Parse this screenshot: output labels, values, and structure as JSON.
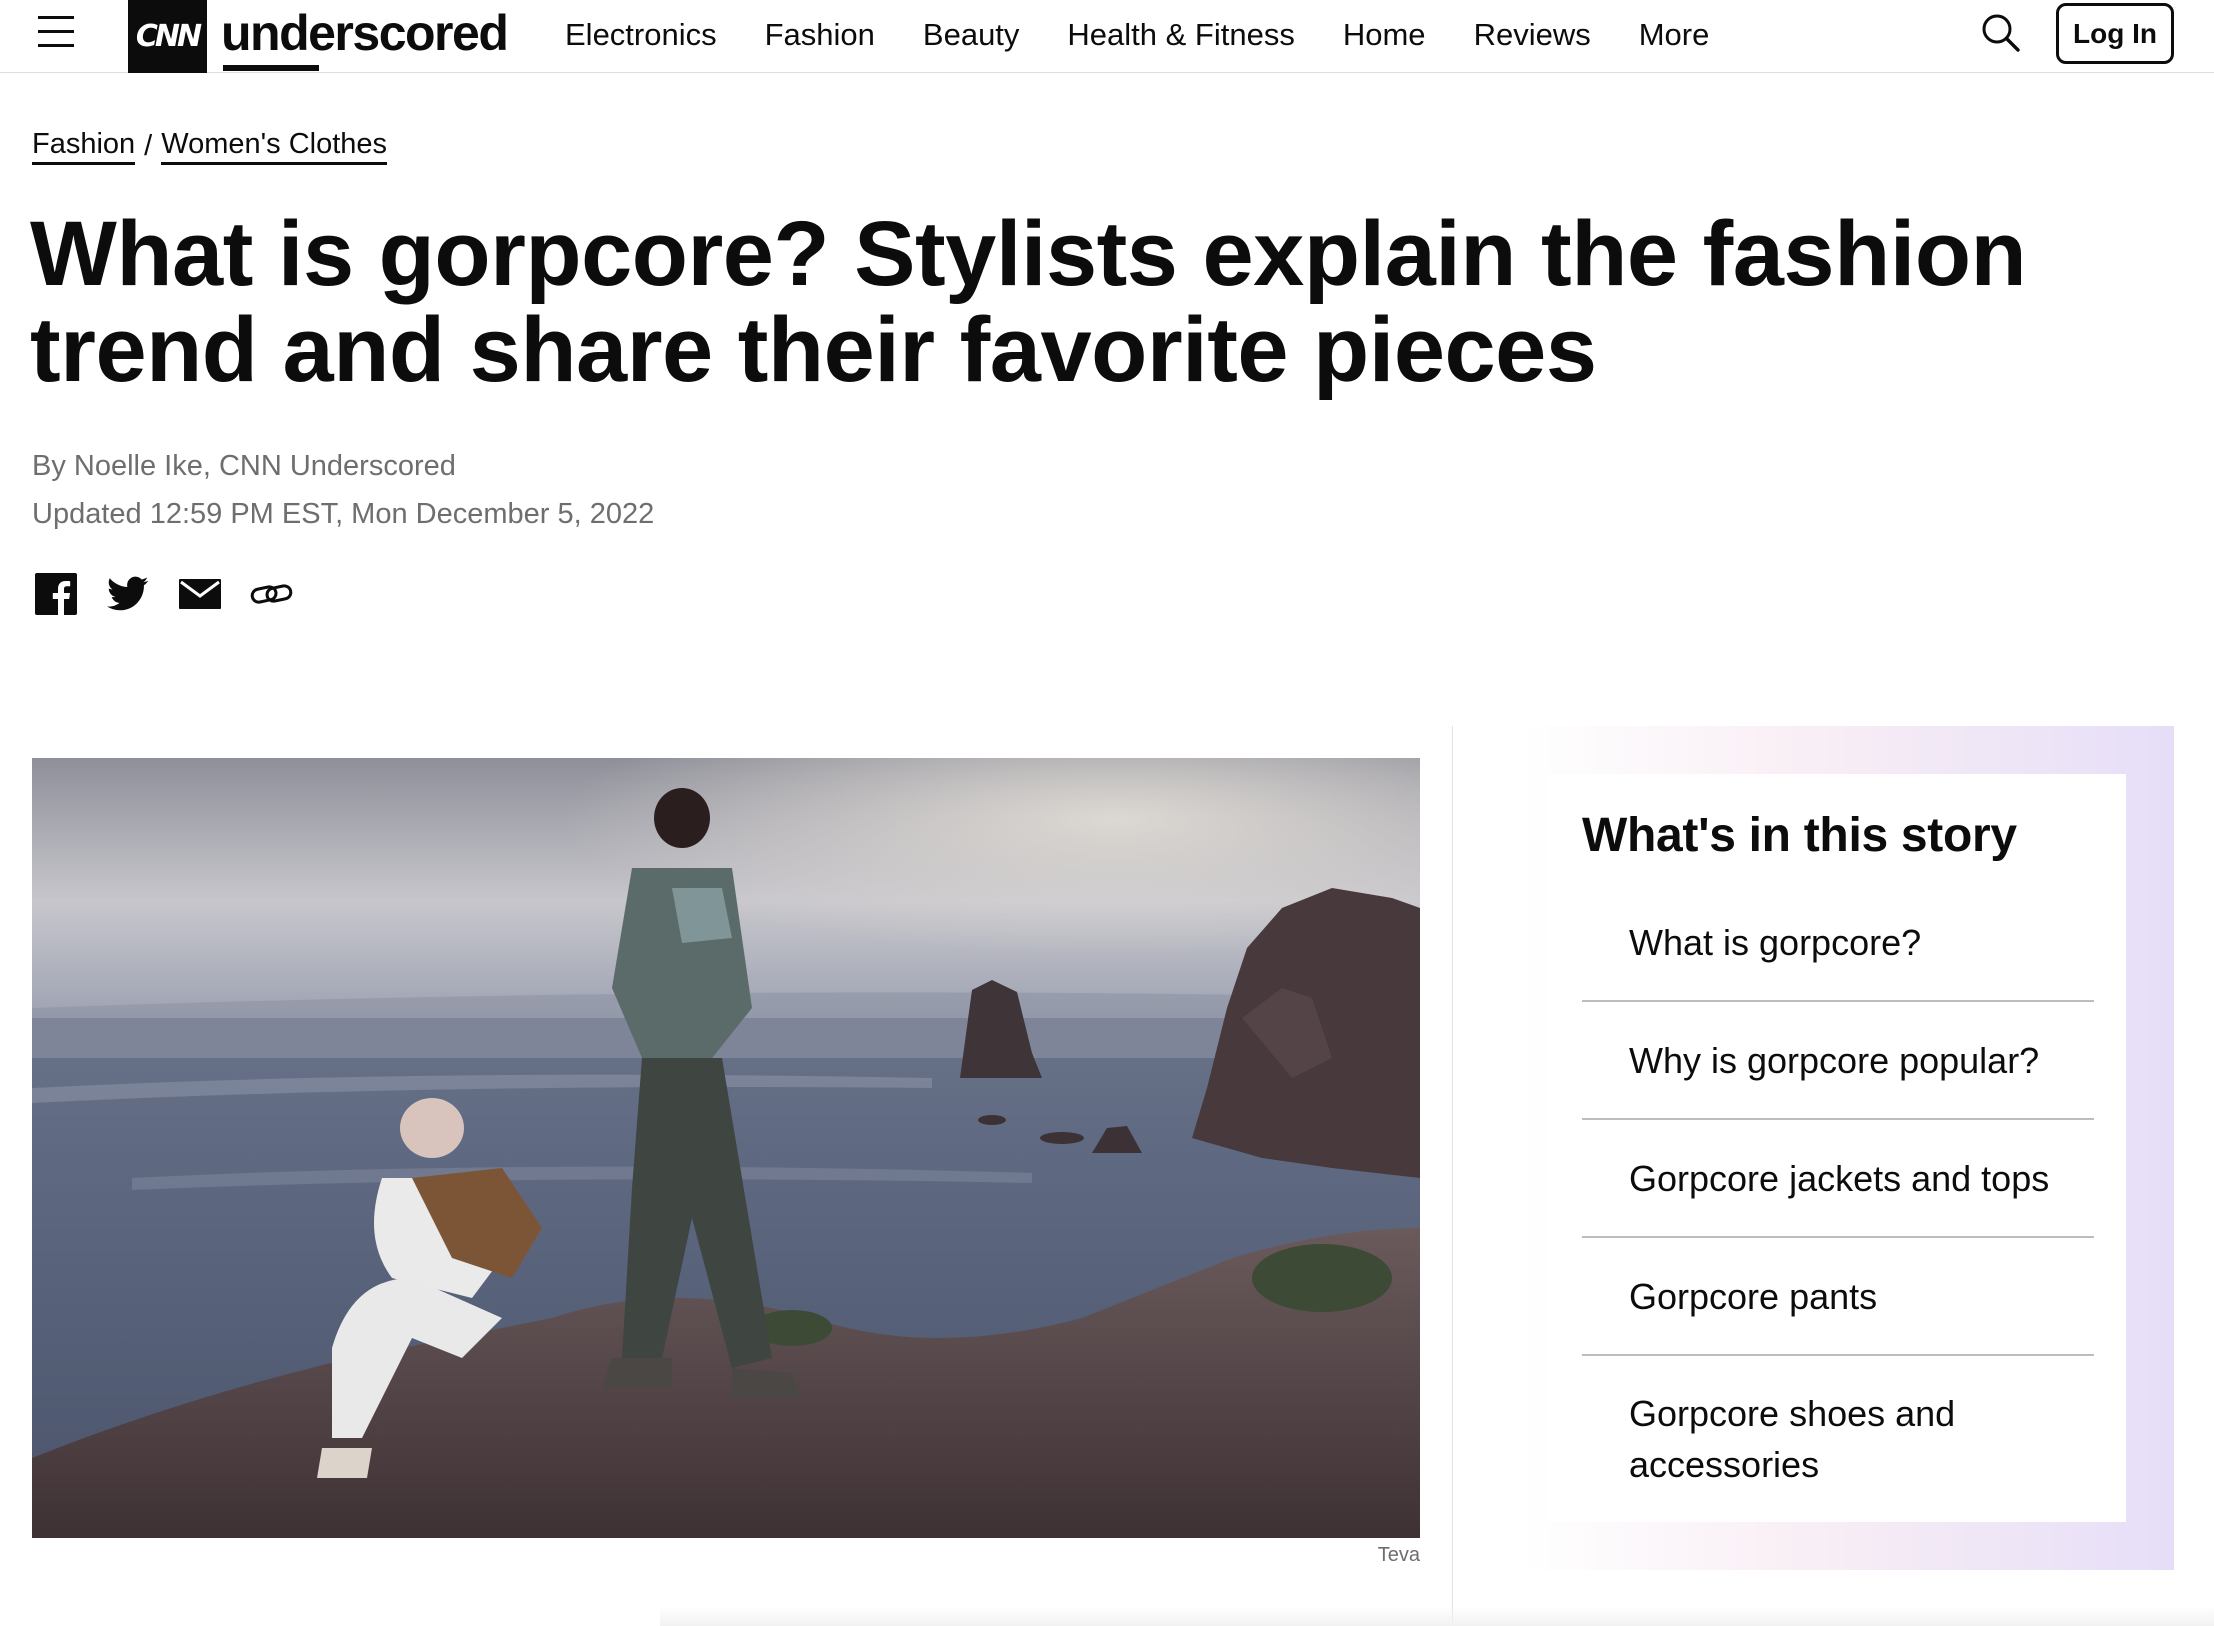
{
  "header": {
    "logo_cnn": "CNN",
    "logo_word": "underscored",
    "nav": [
      "Electronics",
      "Fashion",
      "Beauty",
      "Health & Fitness",
      "Home",
      "Reviews",
      "More"
    ],
    "login_label": "Log In",
    "icons": {
      "menu": "hamburger-menu-icon",
      "search": "search-icon"
    }
  },
  "breadcrumb": {
    "items": [
      "Fashion",
      "Women's Clothes"
    ],
    "separator": "/"
  },
  "article": {
    "headline": "What is gorpcore? Stylists explain the fashion trend and share their favorite pieces",
    "byline": "By Noelle Ike, CNN Underscored",
    "updated": "Updated 12:59 PM EST, Mon December 5, 2022",
    "share_icons": [
      "facebook-icon",
      "twitter-icon",
      "email-icon",
      "link-icon"
    ],
    "image_credit": "Teva"
  },
  "toc": {
    "title": "What's in this story",
    "items": [
      "What is gorpcore?",
      "Why is gorpcore popular?",
      "Gorpcore jackets and tops",
      "Gorpcore pants",
      "Gorpcore shoes and accessories"
    ]
  },
  "colors": {
    "text": "#0c0c0c",
    "muted": "#6e6e6e",
    "rail_pink": "#f8eef5",
    "rail_lavender": "#e6def8"
  }
}
